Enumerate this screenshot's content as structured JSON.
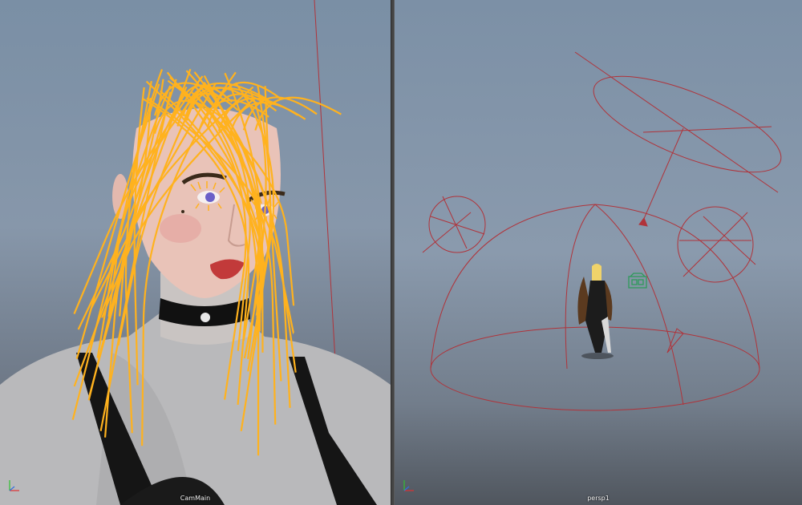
{
  "viewports": [
    {
      "camera": "CamMain"
    },
    {
      "camera": "persp1"
    }
  ],
  "colors": {
    "hair_guides": "#ffb21e",
    "light_wireframe": "#b0333a",
    "background_top": "#7a8fa5",
    "background_bottom": "#4c525a",
    "axis_x": "#e03030",
    "axis_y": "#30c030",
    "axis_z": "#3070e0"
  },
  "icons": {
    "axis_gizmo": "xyz-axis-icon"
  }
}
